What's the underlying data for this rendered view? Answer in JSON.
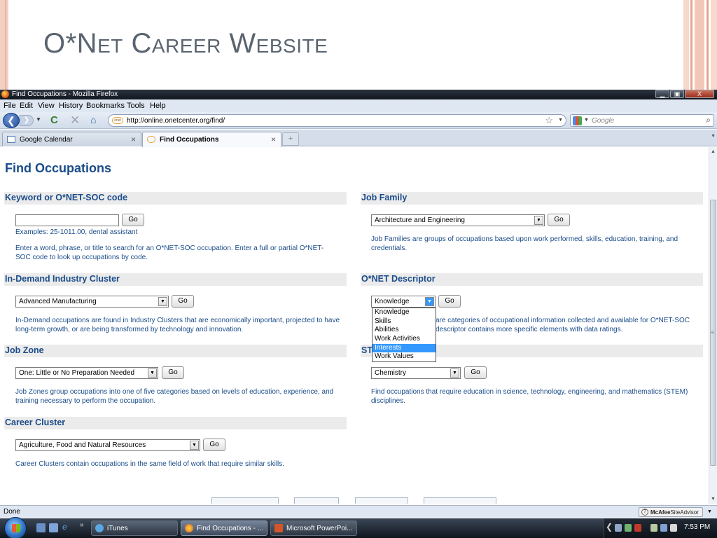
{
  "slide": {
    "title": "O*Net Career Website"
  },
  "window": {
    "title": "Find Occupations - Mozilla Firefox",
    "min": "▁",
    "max": "▣",
    "close": "X"
  },
  "menu": {
    "file": "File",
    "edit": "Edit",
    "view": "View",
    "history": "History",
    "bookmarks": "Bookmarks",
    "tools": "Tools",
    "help": "Help"
  },
  "nav": {
    "url": "http://online.onetcenter.org/find/",
    "search_placeholder": "Google",
    "back": "❮",
    "fwd": "❯",
    "reload": "C",
    "stop": "✕",
    "home": "⌂",
    "star": "☆",
    "magnifier": "⌕",
    "site_icon": "onet"
  },
  "tabs": [
    {
      "label": "Google Calendar",
      "close": "×"
    },
    {
      "label": "Find Occupations",
      "close": "×"
    }
  ],
  "newtab": "+",
  "page": {
    "heading": "Find Occupations",
    "keyword": {
      "header": "Keyword or O*NET-SOC code",
      "input_value": "",
      "go": "Go",
      "examples": "Examples: 25-1011.00, dental assistant",
      "desc": "Enter a word, phrase, or title to search for an O*NET-SOC occupation. Enter a full or partial O*NET-SOC code to look up occupations by code."
    },
    "job_family": {
      "header": "Job Family",
      "selected": "Architecture and Engineering",
      "go": "Go",
      "desc": "Job Families are groups of occupations based upon work performed, skills, education, training, and credentials."
    },
    "industry": {
      "header": "In-Demand Industry Cluster",
      "selected": "Advanced Manufacturing",
      "go": "Go",
      "desc": "In-Demand occupations are found in Industry Clusters that are economically important, projected to have long-term growth, or are being transformed by technology and innovation."
    },
    "descriptor": {
      "header": "O*NET Descriptor",
      "selected": "Knowledge",
      "go": "Go",
      "desc": "are categories of occupational information collected and available for O*NET-SOC descriptor contains more specific elements with data ratings.",
      "options": [
        "Knowledge",
        "Skills",
        "Abilities",
        "Work Activities",
        "Interests",
        "Work Values"
      ],
      "highlighted": "Interests"
    },
    "job_zone": {
      "header": "Job Zone",
      "selected": "One: Little or No Preparation Needed",
      "go": "Go",
      "desc": "Job Zones group occupations into one of five categories based on levels of education, experience, and training necessary to perform the occupation."
    },
    "stem": {
      "header": "ST",
      "selected": "Chemistry",
      "go": "Go",
      "desc": "Find occupations that require education in science, technology, engineering, and mathematics (STEM) disciplines."
    },
    "career": {
      "header": "Career Cluster",
      "selected": "Agriculture, Food and Natural Resources",
      "go": "Go",
      "desc": "Career Clusters contain occupations in the same field of work that require similar skills."
    }
  },
  "status": {
    "text": "Done",
    "mcafee_brand": "McAfee",
    "mcafee_product": "SiteAdvisor"
  },
  "taskbar": {
    "items": [
      {
        "label": "iTunes"
      },
      {
        "label": "Find Occupations - ..."
      },
      {
        "label": "Microsoft PowerPoi..."
      }
    ],
    "chevron": "»",
    "time": "7:53 PM",
    "tray_left": "❮"
  },
  "colors": {
    "link_blue": "#1a4c8a",
    "section_bg": "#ebebeb",
    "highlight": "#3399ff",
    "slide_accent": "#e9a38d"
  }
}
